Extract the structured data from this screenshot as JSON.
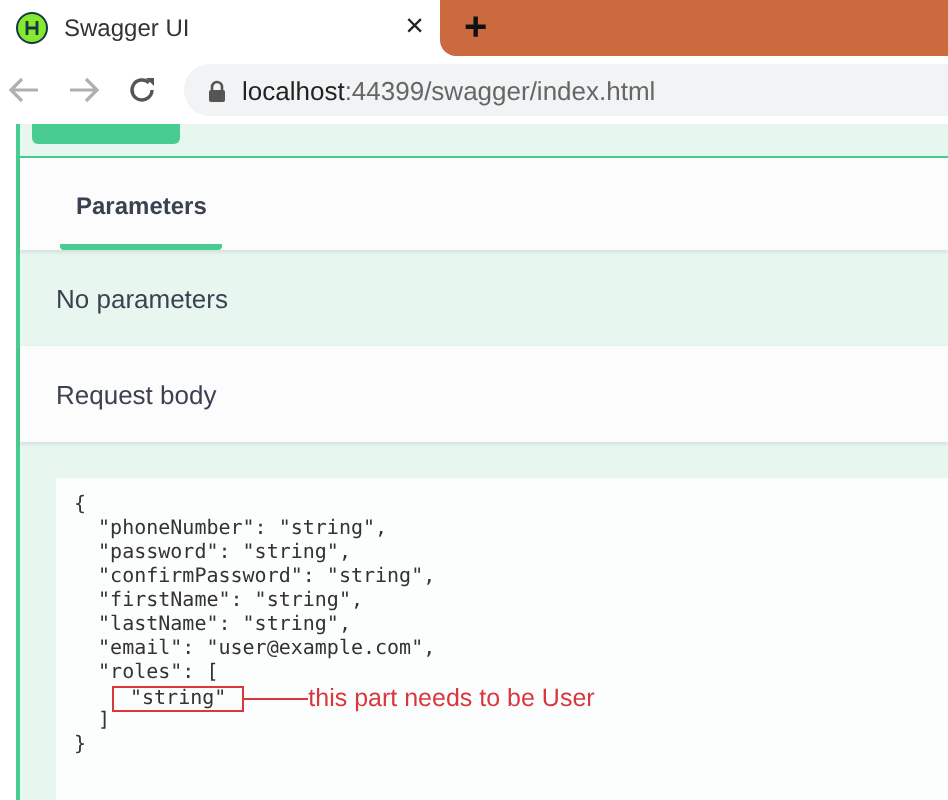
{
  "browser": {
    "tab": {
      "title": "Swagger UI",
      "close": "×"
    },
    "new_tab": "+",
    "url": {
      "host": "localhost",
      "rest": ":44399/swagger/index.html"
    }
  },
  "tabs": [
    {
      "label": "Parameters",
      "selected": true
    }
  ],
  "parameters_text": "No parameters",
  "request_body_label": "Request body",
  "code_lines": [
    {
      "kind": "plain",
      "text": "{"
    },
    {
      "kind": "plain",
      "text": "  \"phoneNumber\": \"string\","
    },
    {
      "kind": "plain",
      "text": "  \"password\": \"string\","
    },
    {
      "kind": "plain",
      "text": "  \"confirmPassword\": \"string\","
    },
    {
      "kind": "plain",
      "text": "  \"firstName\": \"string\","
    },
    {
      "kind": "plain",
      "text": "  \"lastName\": \"string\","
    },
    {
      "kind": "plain",
      "text": "  \"email\": \"user@example.com\","
    },
    {
      "kind": "plain",
      "text": "  \"roles\": ["
    },
    {
      "kind": "boxed",
      "text": "\"string\"",
      "note": "this part needs to be User"
    },
    {
      "kind": "plain",
      "text": "  ]"
    },
    {
      "kind": "plain",
      "text": "}"
    }
  ]
}
